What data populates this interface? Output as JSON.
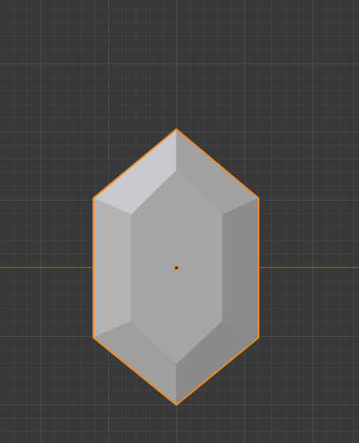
{
  "viewport": {
    "view": "top-orthographic",
    "background_color": "#393939",
    "grid": {
      "minor_color": "#414141",
      "major_color": "#4a4a4a",
      "x_axis_color": "#c23a45"
    }
  },
  "object": {
    "shape": "hexagonal-gem",
    "selected": true,
    "selection_outline_color": "#f08a1c",
    "origin_point_color": "#f08a1c",
    "face_colors": {
      "top_left_bevel": "#c7c9cc",
      "top_right_bevel": "#a2a2a2",
      "left_bevel": "#b2b3b5",
      "right_bevel": "#8c8c8c",
      "bottom_left_bevel": "#9f9f9f",
      "bottom_right_bevel": "#8a8a8a",
      "center_face": "#a5a5a6"
    }
  }
}
